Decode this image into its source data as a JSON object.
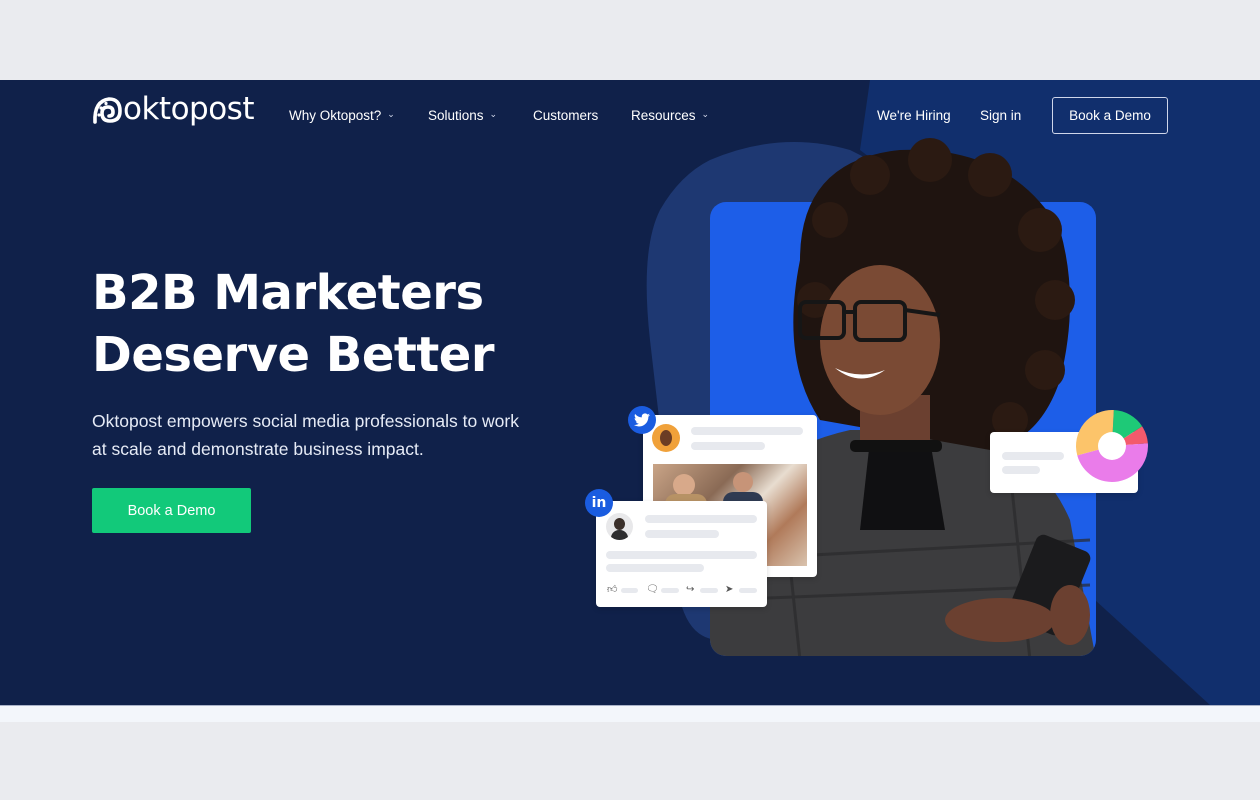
{
  "brand": {
    "name": "oktopost",
    "logo_icon": "octopus-swirl-icon"
  },
  "nav": {
    "items": [
      {
        "label": "Why Oktopost?",
        "has_dropdown": true
      },
      {
        "label": "Solutions",
        "has_dropdown": true
      },
      {
        "label": "Customers",
        "has_dropdown": false
      },
      {
        "label": "Resources",
        "has_dropdown": true
      }
    ],
    "right_links": [
      {
        "label": "We're Hiring"
      },
      {
        "label": "Sign in"
      }
    ],
    "cta_label": "Book a Demo",
    "dropdown_glyph": "⌄"
  },
  "hero": {
    "headline_line1": "B2B Marketers",
    "headline_line2": "Deserve Better",
    "subtext": "Oktopost empowers social media professionals to work at scale and demonstrate business impact.",
    "cta_label": "Book a Demo"
  },
  "illustration": {
    "twitter_badge": "twitter-bird-icon",
    "linkedin_badge_text": "in",
    "action_icons": [
      "like-icon",
      "comment-icon",
      "share-icon",
      "send-icon"
    ],
    "donut_segments": [
      {
        "label": "yellow",
        "color": "#fcc46a",
        "fraction": 0.3
      },
      {
        "label": "green",
        "color": "#1ec977",
        "fraction": 0.15
      },
      {
        "label": "red",
        "color": "#f35a6c",
        "fraction": 0.08
      },
      {
        "label": "pink",
        "color": "#ea7cea",
        "fraction": 0.47
      }
    ]
  },
  "colors": {
    "page_bg": "#eaebef",
    "hero_bg": "#10214a",
    "hero_accent": "#112f6d",
    "photo_bg": "#1d5ee8",
    "cta_green": "#12c97a",
    "badge_blue": "#1a5ce0"
  }
}
